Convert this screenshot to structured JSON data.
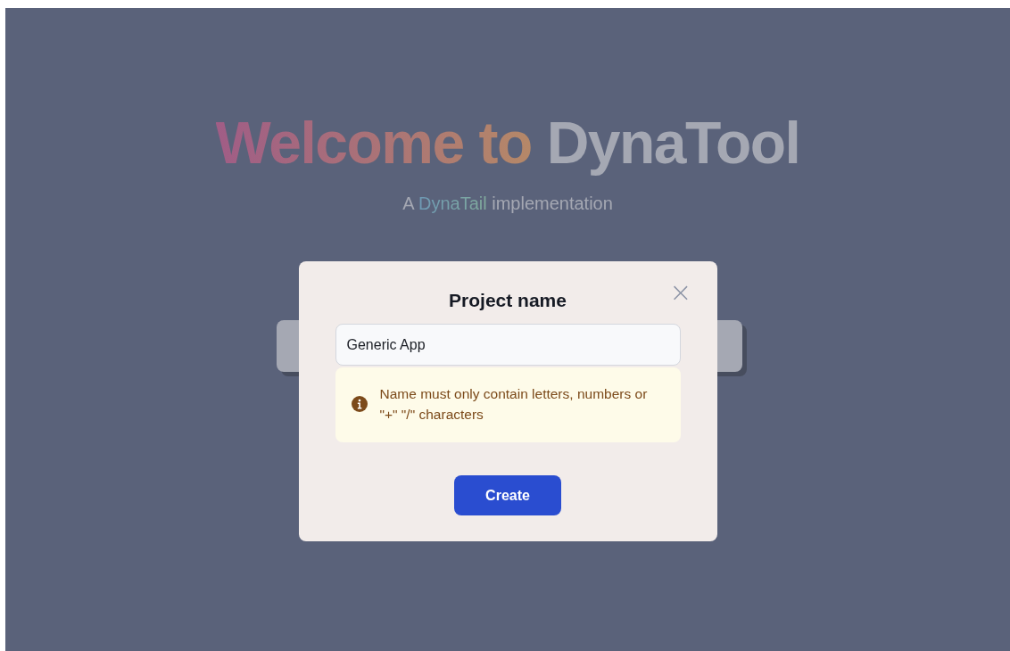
{
  "hero": {
    "title_highlight": "Welcome to",
    "title_rest": "DynaTool",
    "subtitle_prefix": "A",
    "subtitle_brand": "DynaTail",
    "subtitle_suffix": "implementation"
  },
  "modal": {
    "title": "Project name",
    "close": "×",
    "input": {
      "value": "Generic App"
    },
    "alert": {
      "kind": "warning",
      "text": "Name must only contain letters, numbers or \"+\" \"/\" characters"
    },
    "button": "Create"
  }
}
